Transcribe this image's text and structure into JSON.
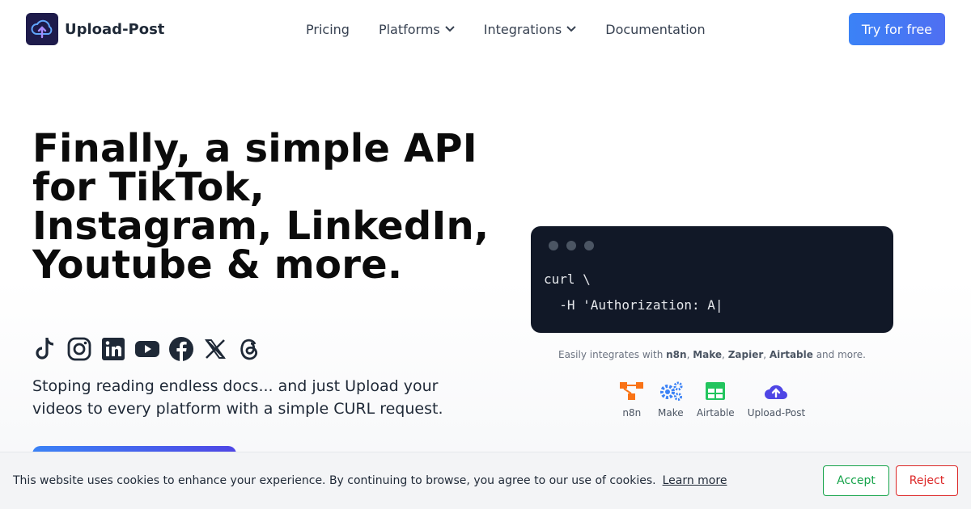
{
  "header": {
    "brand": "Upload-Post",
    "logo_icon": "cloud-upload-icon",
    "nav": [
      {
        "label": "Pricing",
        "dropdown": false
      },
      {
        "label": "Platforms",
        "dropdown": true
      },
      {
        "label": "Integrations",
        "dropdown": true
      },
      {
        "label": "Documentation",
        "dropdown": false
      }
    ],
    "cta_label": "Try for free"
  },
  "hero": {
    "title": "Finally, a simple API for TikTok, Instagram, LinkedIn, Youtube & more.",
    "social_icons": [
      "tiktok-icon",
      "instagram-icon",
      "linkedin-icon",
      "youtube-icon",
      "facebook-icon",
      "x-icon",
      "threads-icon"
    ],
    "subtitle": "Stoping reading endless docs... and just Upload your videos to every platform with a simple CURL request."
  },
  "code": {
    "lines": [
      "curl \\",
      "  -H 'Authorization: A|"
    ]
  },
  "integrations": {
    "prefix": "Easily integrates with ",
    "names": [
      "n8n",
      "Make",
      "Zapier",
      "Airtable"
    ],
    "suffix": " and more.",
    "items": [
      {
        "label": "n8n",
        "icon": "n8n-icon",
        "color": "#f97316"
      },
      {
        "label": "Make",
        "icon": "gears-icon",
        "color": "#3b82f6"
      },
      {
        "label": "Airtable",
        "icon": "table-icon",
        "color": "#22c55e"
      },
      {
        "label": "Upload-Post",
        "icon": "cloud-upload-icon",
        "color": "#4f46e5"
      }
    ]
  },
  "cookie": {
    "text": "This website uses cookies to enhance your experience. By continuing to browse, you agree to our use of cookies.",
    "learn_more": "Learn more",
    "accept": "Accept",
    "reject": "Reject"
  },
  "colors": {
    "accent": "#3b82f6",
    "accent2": "#4f46e5",
    "code_bg": "#111827",
    "accept": "#16a34a",
    "reject": "#dc2626"
  }
}
